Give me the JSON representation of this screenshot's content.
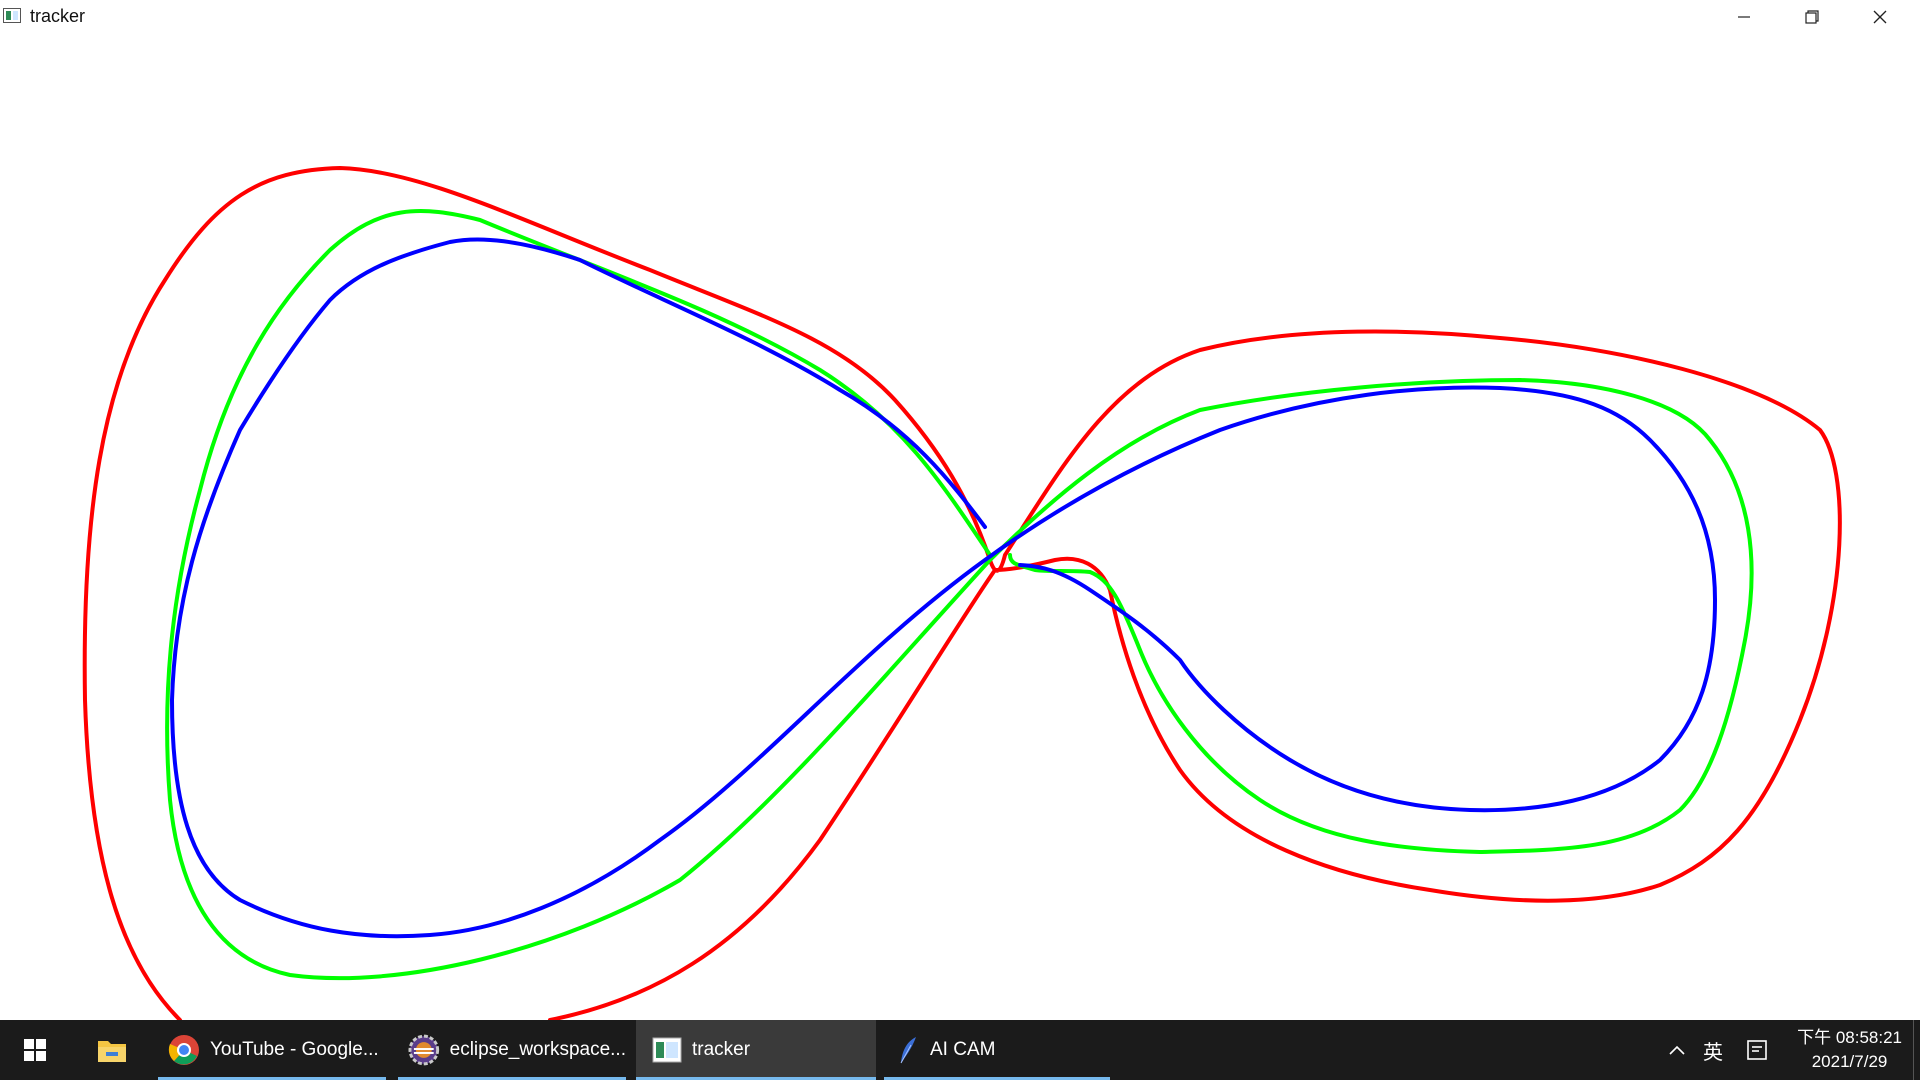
{
  "window": {
    "title": "tracker",
    "icon": "tracker-app-icon",
    "controls": [
      "minimize-icon",
      "restore-icon",
      "close-icon"
    ]
  },
  "trajectories": [
    {
      "name": "red-trajectory",
      "color": "#ff0000"
    },
    {
      "name": "green-trajectory",
      "color": "#00ff00"
    },
    {
      "name": "blue-trajectory",
      "color": "#0000ff"
    }
  ],
  "taskbar": {
    "start_icon": "windows-start-icon",
    "pinned": [
      {
        "icon": "file-explorer-icon"
      }
    ],
    "apps": [
      {
        "label": "YouTube - Google...",
        "icon": "chrome-icon",
        "active": false
      },
      {
        "label": "eclipse_workspace...",
        "icon": "eclipse-icon",
        "active": false
      },
      {
        "label": "tracker",
        "icon": "tracker-app-icon",
        "active": true
      },
      {
        "label": "AI CAM",
        "icon": "feather-icon",
        "active": false
      }
    ],
    "tray": {
      "chevron_icon": "chevron-up-icon",
      "ime_label": "英",
      "notification_icon": "notification-icon",
      "time": "下午 08:58:21",
      "date": "2021/7/29"
    }
  }
}
